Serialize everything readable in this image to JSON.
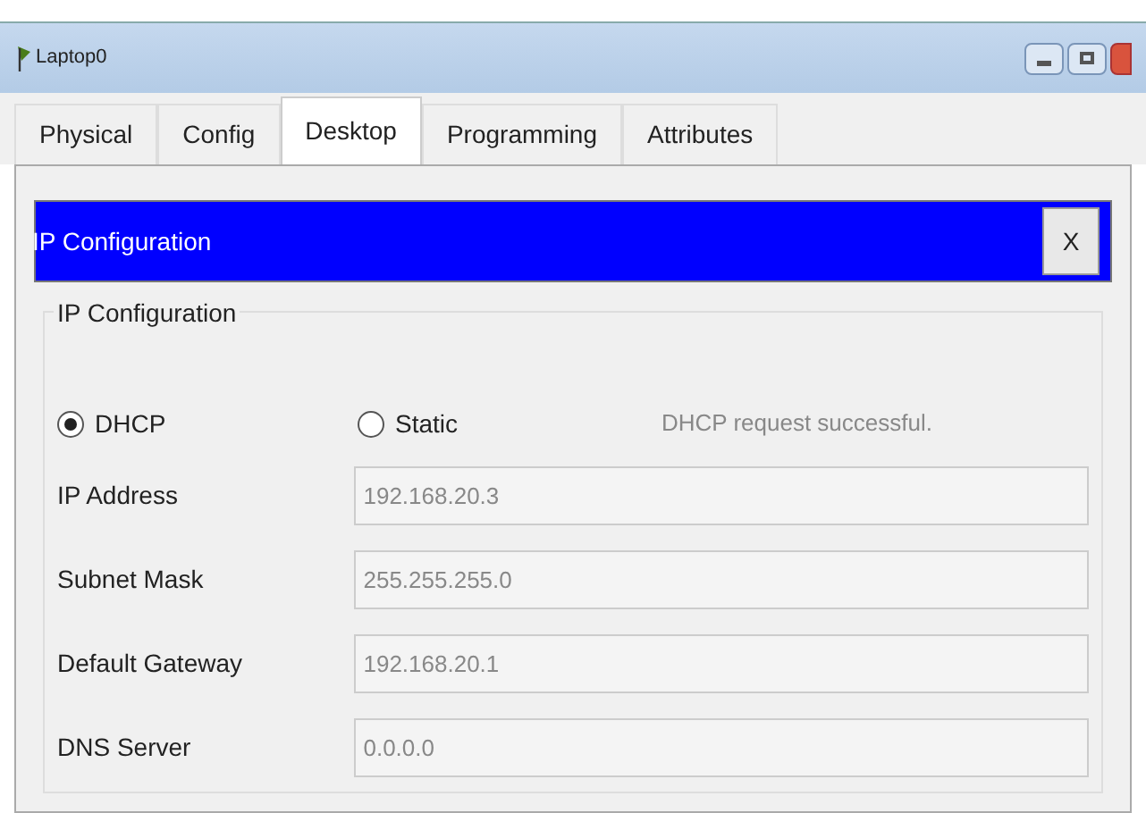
{
  "window": {
    "title": "Laptop0"
  },
  "tabs": [
    {
      "label": "Physical",
      "selected": false
    },
    {
      "label": "Config",
      "selected": false
    },
    {
      "label": "Desktop",
      "selected": true
    },
    {
      "label": "Programming",
      "selected": false
    },
    {
      "label": "Attributes",
      "selected": false
    }
  ],
  "app_header": {
    "title": "IP Configuration",
    "close": "X"
  },
  "group": {
    "title": "IP Configuration",
    "modes": [
      {
        "label": "DHCP",
        "selected": true
      },
      {
        "label": "Static",
        "selected": false
      }
    ],
    "status": "DHCP request successful.",
    "fields": [
      {
        "label": "IP Address",
        "value": "192.168.20.3",
        "disabled": true
      },
      {
        "label": "Subnet Mask",
        "value": "255.255.255.0",
        "disabled": true
      },
      {
        "label": "Default Gateway",
        "value": "192.168.20.1",
        "disabled": true
      },
      {
        "label": "DNS Server",
        "value": "0.0.0.0",
        "disabled": true
      }
    ]
  }
}
